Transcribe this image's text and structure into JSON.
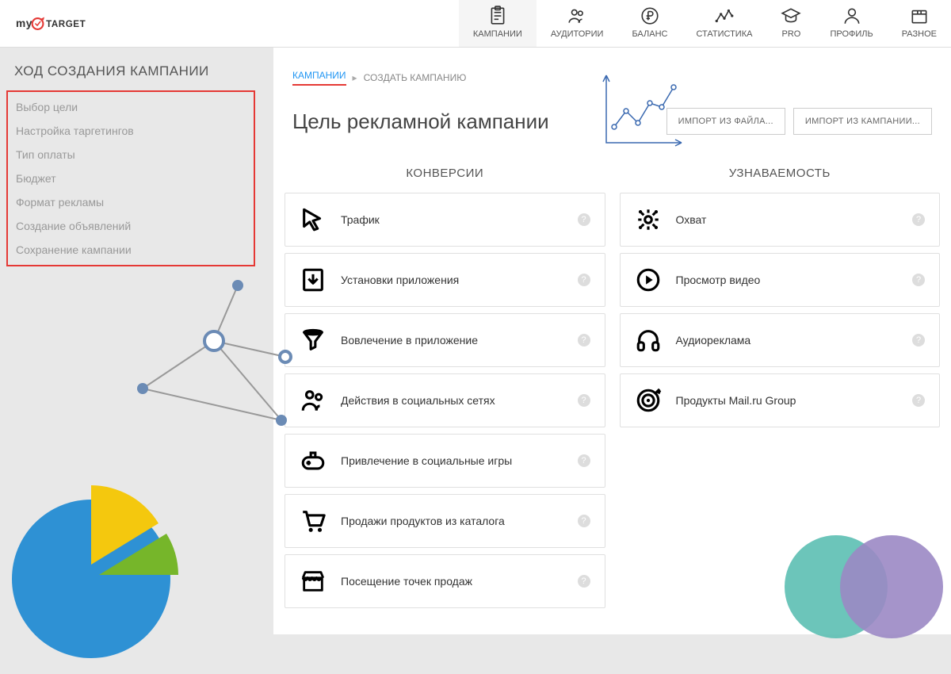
{
  "logo": {
    "text_my": "my",
    "text_target": "TARGET"
  },
  "nav": [
    {
      "id": "campaigns",
      "label": "КАМПАНИИ",
      "active": true
    },
    {
      "id": "audiences",
      "label": "АУДИТОРИИ"
    },
    {
      "id": "balance",
      "label": "БАЛАНС"
    },
    {
      "id": "stats",
      "label": "СТАТИСТИКА"
    },
    {
      "id": "pro",
      "label": "PRO"
    },
    {
      "id": "profile",
      "label": "ПРОФИЛЬ"
    },
    {
      "id": "misc",
      "label": "РАЗНОЕ"
    }
  ],
  "sidebar": {
    "title": "ХОД СОЗДАНИЯ КАМПАНИИ",
    "items": [
      "Выбор цели",
      "Настройка таргетингов",
      "Тип оплаты",
      "Бюджет",
      "Формат рекламы",
      "Создание объявлений",
      "Сохранение кампании"
    ]
  },
  "breadcrumb": {
    "link": "КАМПАНИИ",
    "current": "СОЗДАТЬ КАМПАНИЮ"
  },
  "page_title": "Цель рекламной кампании",
  "buttons": {
    "import_file": "ИМПОРТ ИЗ ФАЙЛА...",
    "import_campaign": "ИМПОРТ ИЗ КАМПАНИИ..."
  },
  "columns": {
    "conversions": {
      "title": "КОНВЕРСИИ",
      "items": [
        {
          "icon": "cursor",
          "label": "Трафик"
        },
        {
          "icon": "download",
          "label": "Установки приложения"
        },
        {
          "icon": "funnel",
          "label": "Вовлечение в приложение"
        },
        {
          "icon": "social",
          "label": "Действия в социальных сетях"
        },
        {
          "icon": "gamepad",
          "label": "Привлечение в социальные игры"
        },
        {
          "icon": "cart",
          "label": "Продажи продуктов из каталога"
        },
        {
          "icon": "store",
          "label": "Посещение точек продаж"
        }
      ]
    },
    "awareness": {
      "title": "УЗНАВАЕМОСТЬ",
      "items": [
        {
          "icon": "reach",
          "label": "Охват"
        },
        {
          "icon": "play",
          "label": "Просмотр видео"
        },
        {
          "icon": "headphones",
          "label": "Аудиореклама"
        },
        {
          "icon": "target",
          "label": "Продукты Mail.ru Group"
        }
      ]
    }
  },
  "colors": {
    "red": "#e53935",
    "blue": "#2196f3"
  }
}
